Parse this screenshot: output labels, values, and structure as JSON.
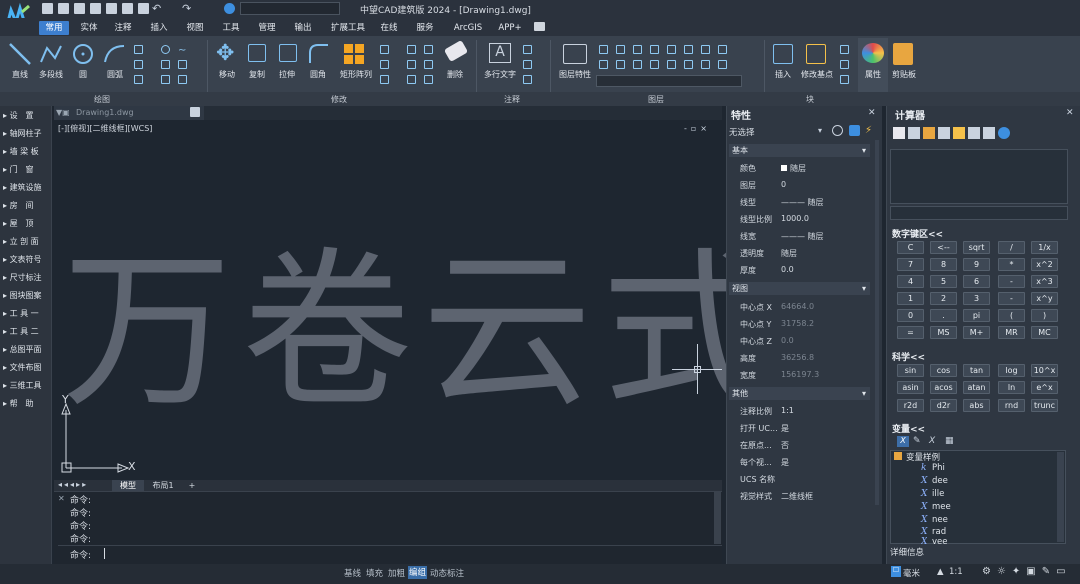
{
  "app": {
    "title": "中望CAD建筑版 2024 - [Drawing1.dwg]"
  },
  "ribbon": {
    "tabs": [
      {
        "label": "常用"
      },
      {
        "label": "实体"
      },
      {
        "label": "注释"
      },
      {
        "label": "插入"
      },
      {
        "label": "视图"
      },
      {
        "label": "工具"
      },
      {
        "label": "管理"
      },
      {
        "label": "输出"
      },
      {
        "label": "扩展工具"
      },
      {
        "label": "在线"
      },
      {
        "label": "服务"
      },
      {
        "label": "ArcGIS"
      },
      {
        "label": "APP+"
      }
    ],
    "draw": {
      "line": "直线",
      "polyline": "多段线",
      "circle": "圆",
      "arc": "圆弧"
    },
    "modify": {
      "move": "移动",
      "copy": "复制",
      "stretch": "拉伸",
      "fillet": "圆角",
      "array": "矩形阵列",
      "erase": "删除"
    },
    "annotation": {
      "mtext": "多行文字"
    },
    "layer": {
      "layer_props": "图层特性"
    },
    "block": {
      "insert": "插入",
      "edit_base": "修改基点"
    },
    "properties_btn": "属性",
    "clipboard_btn": "剪贴板",
    "panels": {
      "draw": "绘图",
      "modify": "修改",
      "annotation": "注释",
      "layer": "图层",
      "block": "块"
    }
  },
  "sidebar": {
    "items": [
      {
        "label": "设　置"
      },
      {
        "label": "轴网柱子"
      },
      {
        "label": "墙 梁 板"
      },
      {
        "label": "门　窗"
      },
      {
        "label": "建筑设施"
      },
      {
        "label": "房　间"
      },
      {
        "label": "屋　顶"
      },
      {
        "label": "立 剖 面"
      },
      {
        "label": "文表符号"
      },
      {
        "label": "尺寸标注"
      },
      {
        "label": "图块图案"
      },
      {
        "label": "工 具 一"
      },
      {
        "label": "工 具 二"
      },
      {
        "label": "总图平面"
      },
      {
        "label": "文件布图"
      },
      {
        "label": "三维工具"
      },
      {
        "label": "帮　助"
      }
    ]
  },
  "drawing": {
    "doc_tab": "Drawing1.dwg",
    "view_label": "[-][俯视][二维线框][WCS]",
    "watermark": "万卷云式",
    "ucs": {
      "x": "X",
      "y": "Y"
    },
    "layout_tabs": [
      {
        "label": "模型"
      },
      {
        "label": "布局1"
      },
      {
        "label": "+"
      }
    ]
  },
  "command": {
    "history": [
      "命令:",
      "命令:",
      "命令:",
      "命令:"
    ],
    "prompt": "命令:"
  },
  "status": {
    "items": [
      {
        "label": "基线"
      },
      {
        "label": "填充"
      },
      {
        "label": "加粗"
      },
      {
        "label": "编组"
      },
      {
        "label": "动态标注"
      }
    ],
    "active": "编组",
    "unit": "毫米",
    "scale": "1:1"
  },
  "properties": {
    "title": "特性",
    "selection": "无选择",
    "sections": {
      "basic": "基本",
      "view": "视图",
      "other": "其他"
    },
    "basic": [
      {
        "k": "颜色",
        "v": "随层"
      },
      {
        "k": "图层",
        "v": "0"
      },
      {
        "k": "线型",
        "v": "——— 随层"
      },
      {
        "k": "线型比例",
        "v": "1000.0"
      },
      {
        "k": "线宽",
        "v": "——— 随层"
      },
      {
        "k": "透明度",
        "v": "随层"
      },
      {
        "k": "厚度",
        "v": "0.0"
      }
    ],
    "view": [
      {
        "k": "中心点 X",
        "v": "64664.0"
      },
      {
        "k": "中心点 Y",
        "v": "31758.2"
      },
      {
        "k": "中心点 Z",
        "v": "0.0"
      },
      {
        "k": "高度",
        "v": "36256.8"
      },
      {
        "k": "宽度",
        "v": "156197.3"
      }
    ],
    "other": [
      {
        "k": "注释比例",
        "v": "1:1"
      },
      {
        "k": "打开 UC...",
        "v": "是"
      },
      {
        "k": "在原点...",
        "v": "否"
      },
      {
        "k": "每个视...",
        "v": "是"
      },
      {
        "k": "UCS 名称",
        "v": ""
      },
      {
        "k": "视觉样式",
        "v": "二维线框"
      }
    ]
  },
  "calculator": {
    "title": "计算器",
    "numpad_label": "数字键区<<",
    "numpad": [
      [
        "C",
        "<--",
        "sqrt",
        "/",
        "1/x"
      ],
      [
        "7",
        "8",
        "9",
        "*",
        "x^2"
      ],
      [
        "4",
        "5",
        "6",
        "-",
        "x^3"
      ],
      [
        "1",
        "2",
        "3",
        "-",
        "x^y"
      ],
      [
        "0",
        ".",
        "pi",
        "(",
        ")"
      ],
      [
        "=",
        "MS",
        "M+",
        "MR",
        "MC"
      ]
    ],
    "science_label": "科学<<",
    "science": [
      [
        "sin",
        "cos",
        "tan",
        "log",
        "10^x"
      ],
      [
        "asin",
        "acos",
        "atan",
        "ln",
        "e^x"
      ],
      [
        "r2d",
        "d2r",
        "abs",
        "rnd",
        "trunc"
      ]
    ],
    "vars_label": "变量<<",
    "var_group": "变量样例",
    "variables": [
      {
        "sym": "k",
        "name": "Phi"
      },
      {
        "sym": "X",
        "name": "dee"
      },
      {
        "sym": "X",
        "name": "ille"
      },
      {
        "sym": "X",
        "name": "mee"
      },
      {
        "sym": "X",
        "name": "nee"
      },
      {
        "sym": "X",
        "name": "rad"
      },
      {
        "sym": "X",
        "name": "vee"
      }
    ],
    "details_label": "详细信息"
  }
}
